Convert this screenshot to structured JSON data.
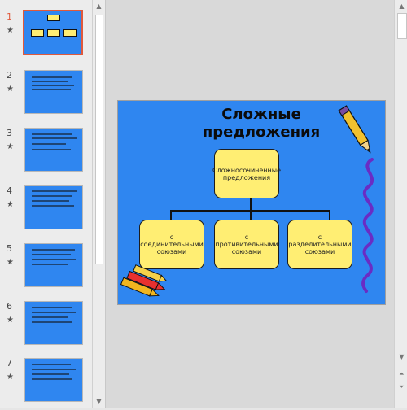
{
  "thumbnails": [
    {
      "number": "1",
      "star": "★",
      "selected": true
    },
    {
      "number": "2",
      "star": "★"
    },
    {
      "number": "3",
      "star": "★"
    },
    {
      "number": "4",
      "star": "★"
    },
    {
      "number": "5",
      "star": "★"
    },
    {
      "number": "6",
      "star": "★"
    },
    {
      "number": "7",
      "star": "★"
    }
  ],
  "slide": {
    "title": "Сложные предложения",
    "top_box": "Сложносочиненные предложения",
    "box_left": "с соединительными союзами",
    "box_mid": "с противительными союзами",
    "box_right": "с разделительными союзами"
  },
  "colors": {
    "slide_bg": "#2f86f0",
    "box_fill": "#ffee73",
    "selection": "#e0593c"
  }
}
